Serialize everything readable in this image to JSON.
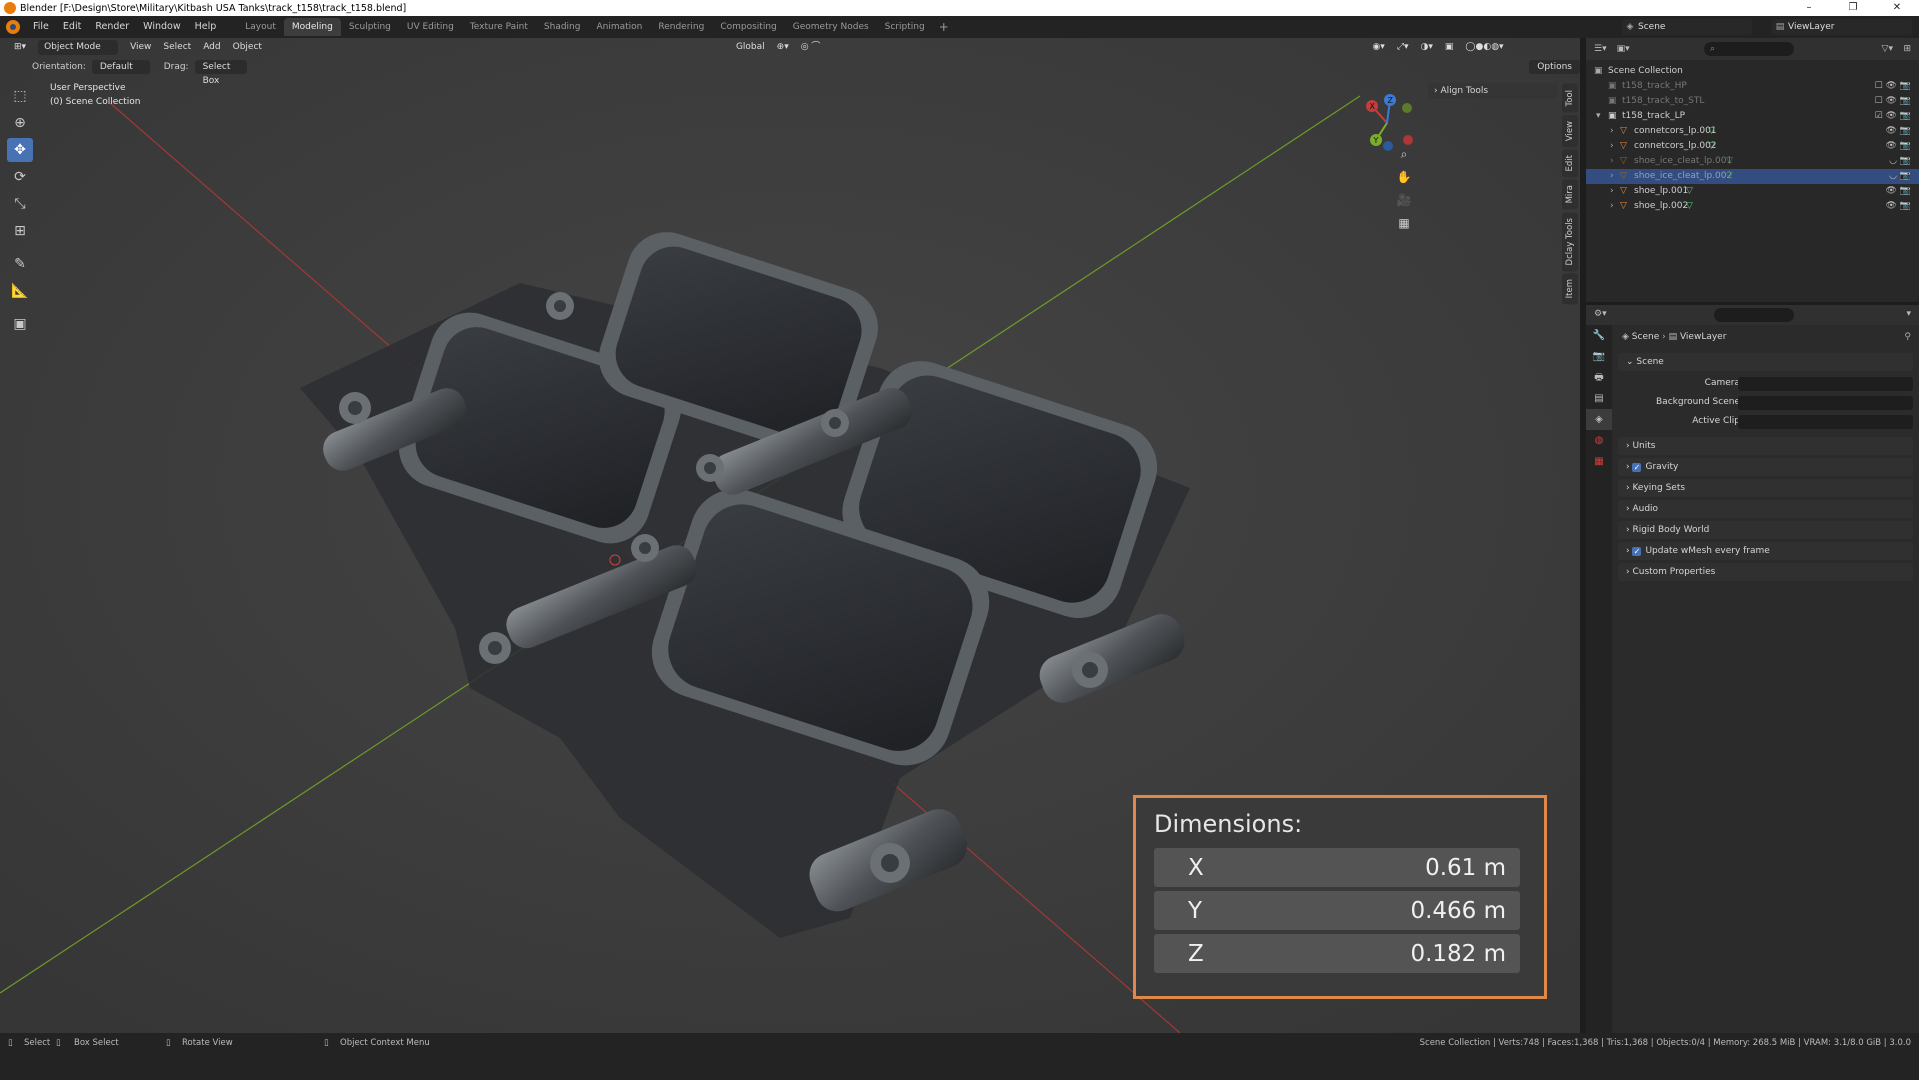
{
  "window": {
    "title": "Blender [F:\\Design\\Store\\Military\\Kitbash USA Tanks\\track_t158\\track_t158.blend]",
    "controls": [
      "–",
      "❐",
      "✕"
    ]
  },
  "menu": [
    "File",
    "Edit",
    "Render",
    "Window",
    "Help"
  ],
  "workspaces": [
    "Layout",
    "Modeling",
    "Sculpting",
    "UV Editing",
    "Texture Paint",
    "Shading",
    "Animation",
    "Rendering",
    "Compositing",
    "Geometry Nodes",
    "Scripting"
  ],
  "active_workspace": "Modeling",
  "scene_selector": "Scene",
  "viewlayer_selector": "ViewLayer",
  "viewport": {
    "header": {
      "mode": "Object Mode",
      "menus": [
        "View",
        "Select",
        "Add",
        "Object"
      ],
      "transform_orientation": "Global",
      "options": "Options"
    },
    "tool_header": {
      "orientation_label": "Orientation:",
      "orientation_value": "Default",
      "drag_label": "Drag:",
      "drag_value": "Select Box"
    },
    "overlay": {
      "perspective": "User Perspective",
      "collection": "(0) Scene Collection"
    },
    "npanel": {
      "tabs": [
        "Tool",
        "View",
        "Edit",
        "Mira",
        "Dclay Tools",
        "Item"
      ],
      "panel": "Align Tools"
    },
    "gizmo_axes": [
      "X",
      "Y",
      "Z"
    ],
    "colors": {
      "x_axis": "#c43c3c",
      "y_axis": "#7aae2a",
      "z_axis": "#3a7bd5",
      "accent": "#4772b3",
      "dimension_border": "#e0874a"
    }
  },
  "dimensions": {
    "title": "Dimensions:",
    "rows": [
      {
        "axis": "X",
        "value": "0.61 m"
      },
      {
        "axis": "Y",
        "value": "0.466 m"
      },
      {
        "axis": "Z",
        "value": "0.182 m"
      }
    ]
  },
  "outliner": {
    "root": "Scene Collection",
    "items": [
      {
        "name": "t158_track_HP",
        "type": "collection",
        "state": "disabled"
      },
      {
        "name": "t158_track_to_STL",
        "type": "collection",
        "state": "disabled"
      },
      {
        "name": "t158_track_LP",
        "type": "collection",
        "state": "normal"
      },
      {
        "name": "connetcors_lp.001",
        "type": "mesh",
        "state": "normal"
      },
      {
        "name": "connetcors_lp.002",
        "type": "mesh",
        "state": "normal"
      },
      {
        "name": "shoe_ice_cleat_lp.001",
        "type": "mesh",
        "state": "hidden"
      },
      {
        "name": "shoe_ice_cleat_lp.002",
        "type": "mesh",
        "state": "selected"
      },
      {
        "name": "shoe_lp.001",
        "type": "mesh",
        "state": "normal"
      },
      {
        "name": "shoe_lp.002",
        "type": "mesh",
        "state": "normal"
      }
    ]
  },
  "properties": {
    "breadcrumb": [
      "Scene",
      "ViewLayer"
    ],
    "scene_panel": "Scene",
    "fields": [
      {
        "label": "Camera"
      },
      {
        "label": "Background Scene"
      },
      {
        "label": "Active Clip"
      }
    ],
    "panels": [
      {
        "label": "Units",
        "checkbox": false
      },
      {
        "label": "Gravity",
        "checkbox": true
      },
      {
        "label": "Keying Sets",
        "checkbox": false
      },
      {
        "label": "Audio",
        "checkbox": false
      },
      {
        "label": "Rigid Body World",
        "checkbox": false
      },
      {
        "label": "Update wMesh every frame",
        "checkbox": true
      },
      {
        "label": "Custom Properties",
        "checkbox": false
      }
    ]
  },
  "statusbar": {
    "select": "Select",
    "box_select": "Box Select",
    "rotate_view": "Rotate View",
    "context_menu": "Object Context Menu",
    "stats": "Scene Collection | Verts:748 | Faces:1,368 | Tris:1,368 | Objects:0/4 | Memory: 268.5 MiB | VRAM: 3.1/8.0 GiB | 3.0.0"
  }
}
